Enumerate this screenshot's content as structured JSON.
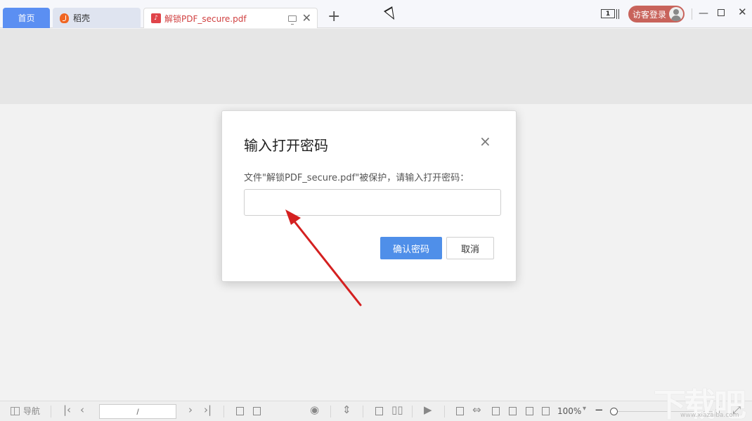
{
  "tabs": [
    {
      "label": "首页"
    },
    {
      "label": "稻壳"
    },
    {
      "label": "解锁PDF_secure.pdf"
    }
  ],
  "header": {
    "new_tab": "+",
    "page_indicator": "1",
    "login_label": "访客登录"
  },
  "dialog": {
    "title": "输入打开密码",
    "close": "×",
    "message": "文件\"解锁PDF_secure.pdf\"被保护，请输入打开密码：",
    "password_value": "",
    "ok_label": "确认密码",
    "cancel_label": "取消"
  },
  "statusbar": {
    "nav_label": "导航",
    "page_value": "/",
    "zoom": "100%",
    "zoom_level_fraction": 0.0
  },
  "watermark": {
    "text": "下载吧",
    "url": "www.xiazaiba.com"
  },
  "colors": {
    "home_tab": "#5b8ff2",
    "login_button": "#c8635b",
    "primary_button": "#4f8fe9",
    "pdf_tab_text": "#d04040",
    "annotation_arrow": "#d42020"
  }
}
